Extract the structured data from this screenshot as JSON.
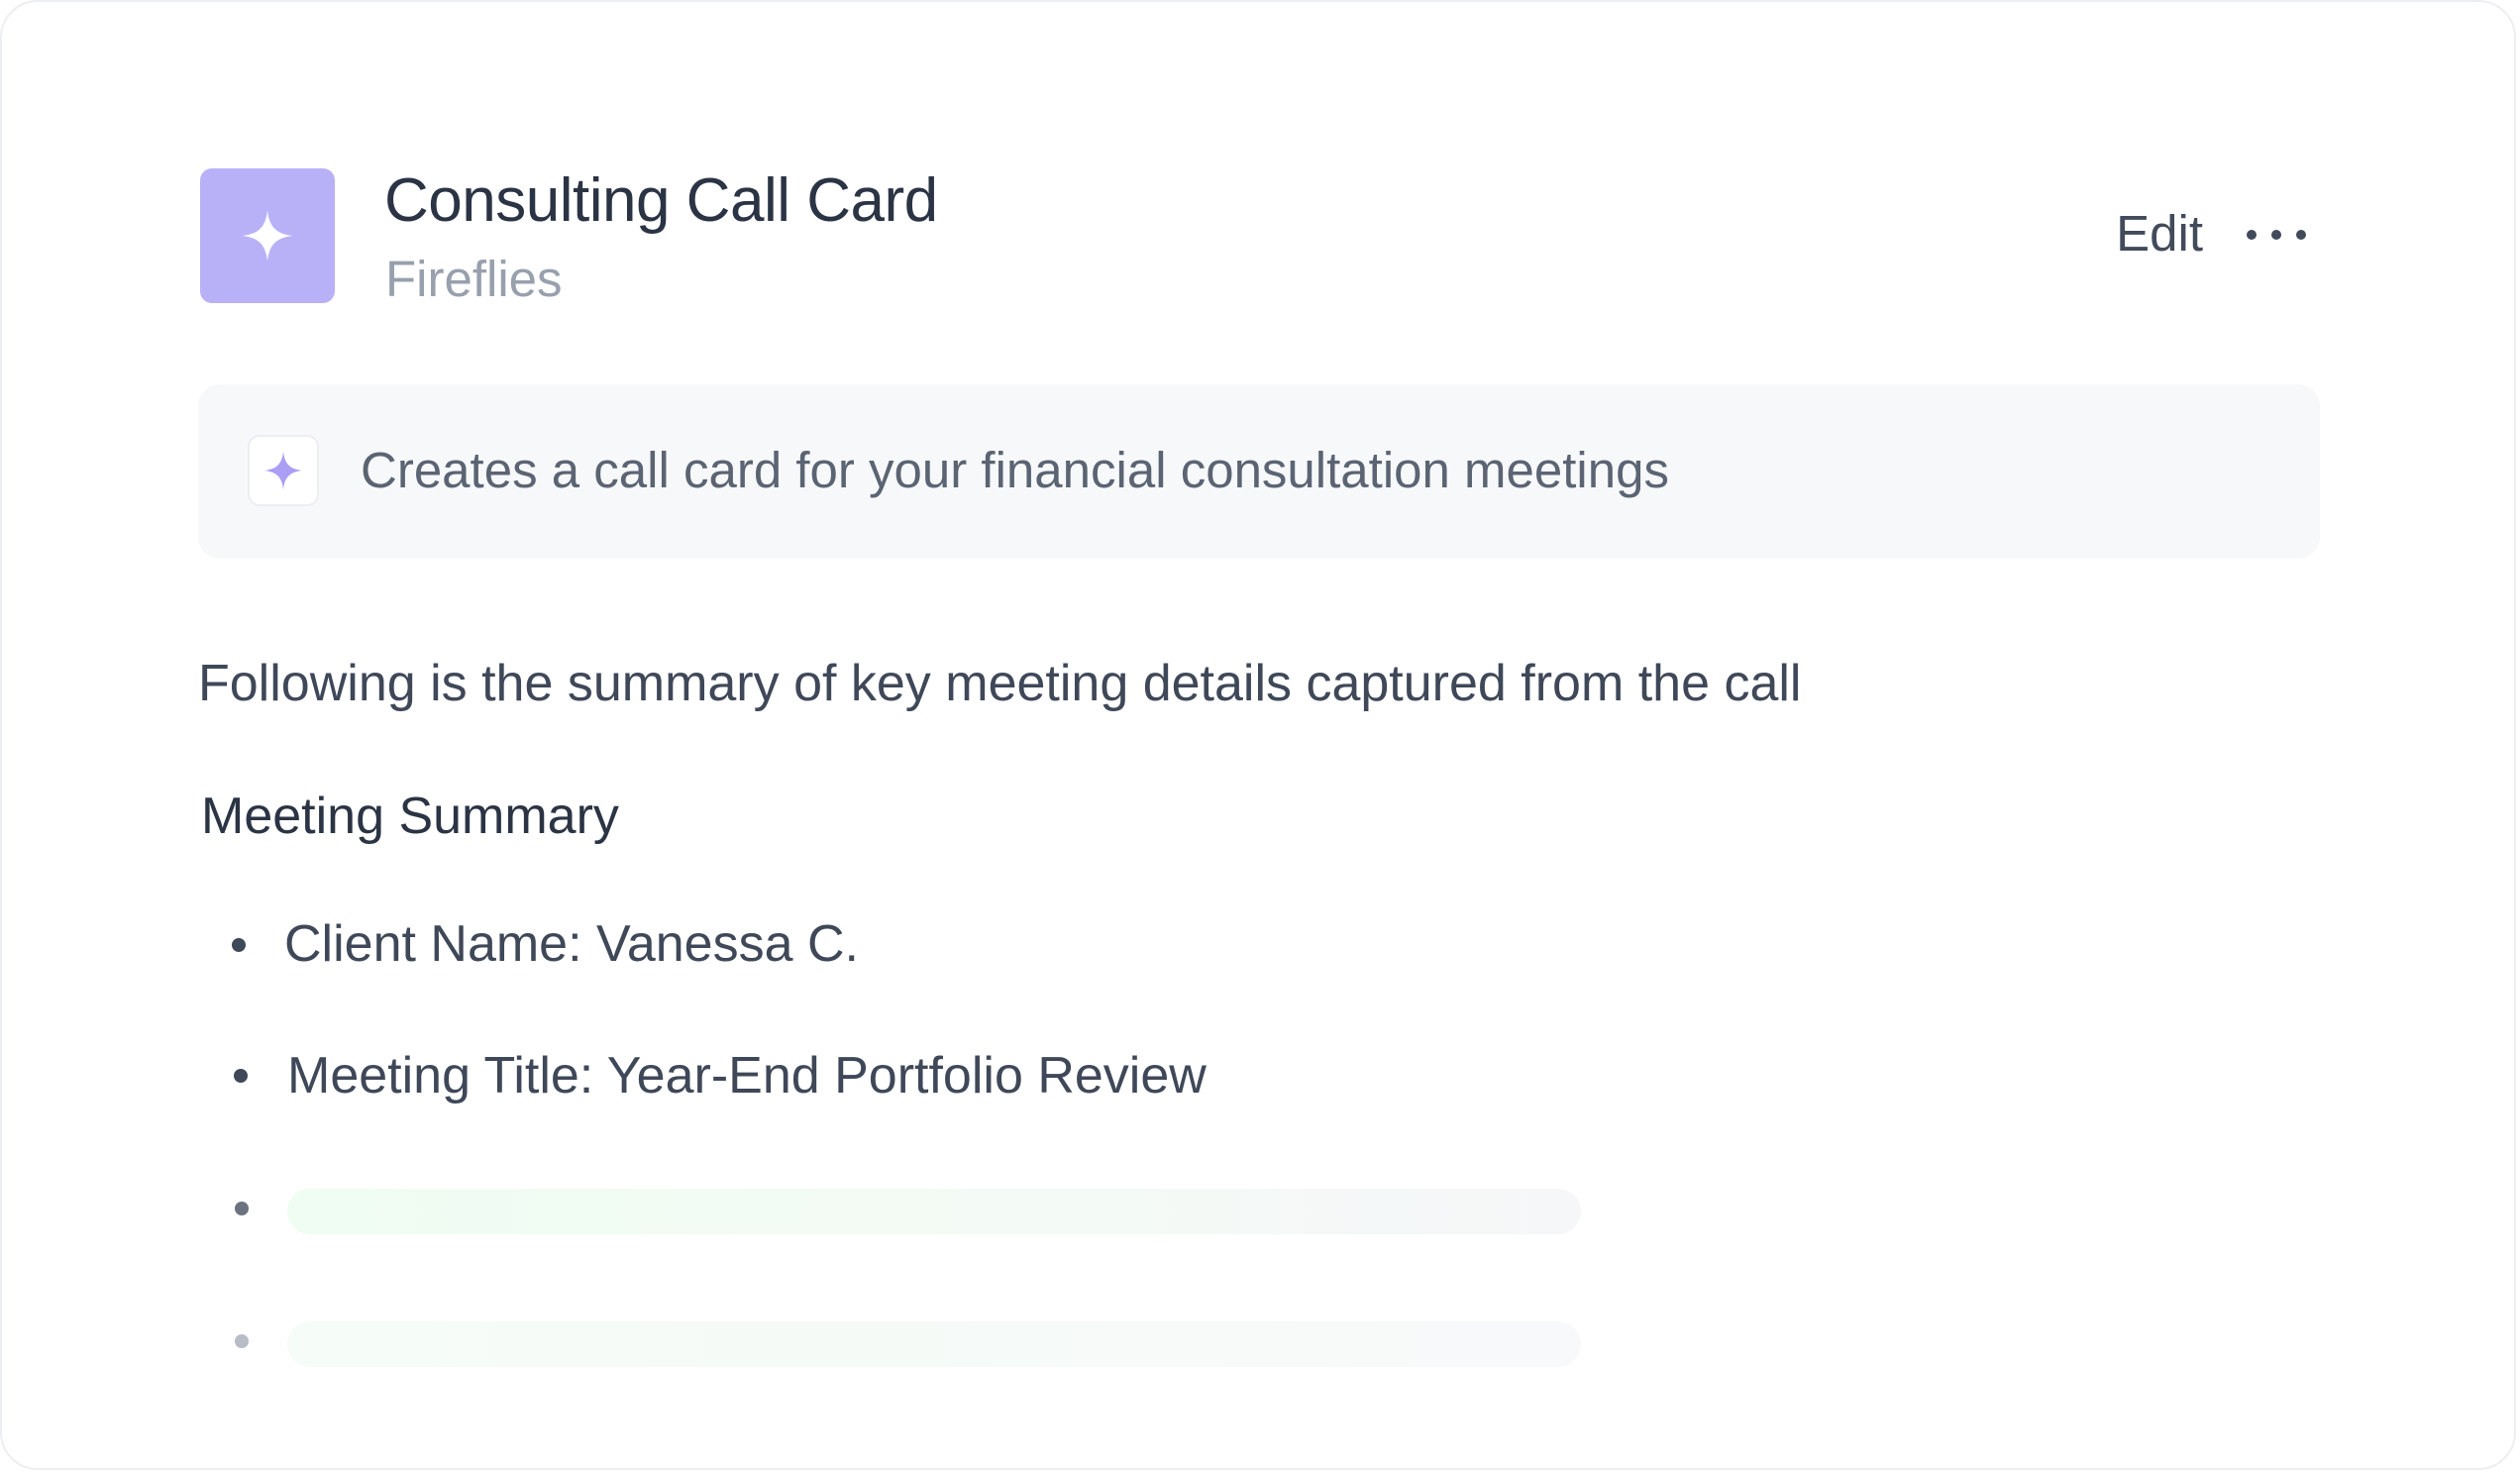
{
  "card": {
    "title": "Consulting Call Card",
    "source": "Fireflies",
    "app_icon": "sparkle-icon",
    "accent_color": "#b9b1f7",
    "actions": {
      "edit_label": "Edit",
      "more_icon": "more-horizontal-icon"
    }
  },
  "banner": {
    "icon": "sparkle-icon",
    "text": "Creates a call card for your financial consultation meetings"
  },
  "content": {
    "intro": "Following is the summary of key meeting details captured from the call",
    "section_title": "Meeting Summary",
    "items": [
      "Client Name: Vanessa C.",
      "Meeting Title: Year-End Portfolio Review"
    ],
    "loading_placeholders": 2
  }
}
